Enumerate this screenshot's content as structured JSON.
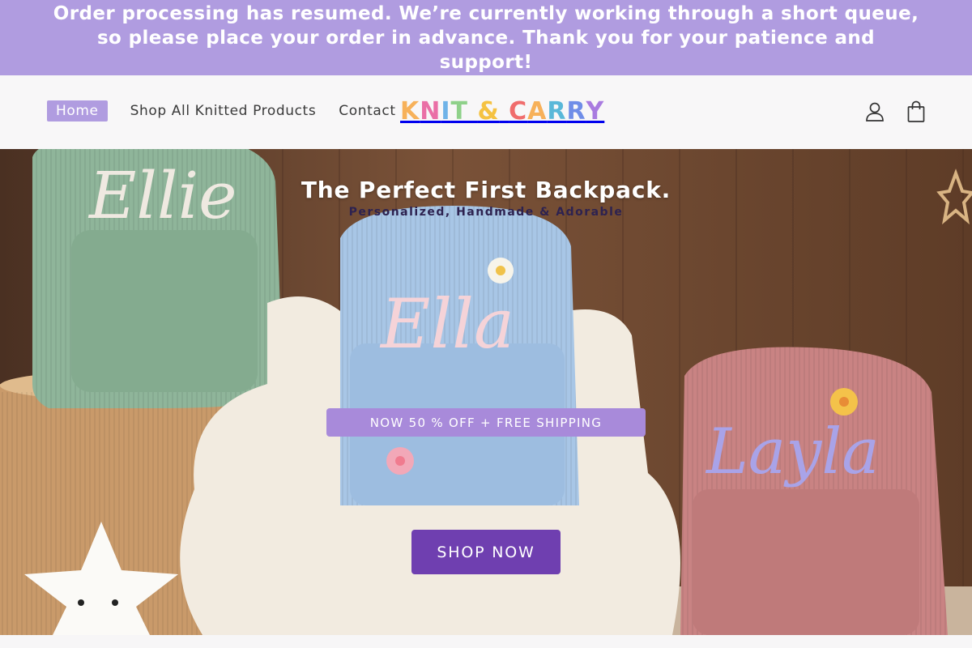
{
  "announcement": {
    "text": "Order processing has resumed. We’re currently working through a short queue, so please place your order in advance. Thank you for your patience and support!"
  },
  "nav": {
    "home": "Home",
    "shop_all": "Shop All Knitted Products",
    "contact": "Contact"
  },
  "logo": {
    "letters": [
      "K",
      "N",
      "I",
      "T",
      " ",
      "&",
      " ",
      "C",
      "A",
      "R",
      "R",
      "Y"
    ],
    "colors": [
      "#f7b15a",
      "#ea6fa6",
      "#6fb3e8",
      "#8fd18a",
      "#000000",
      "#f5c242",
      "#000000",
      "#f06d6d",
      "#f7b15a",
      "#59b8d9",
      "#6f8de8",
      "#a97be0"
    ]
  },
  "icons": {
    "account": "account-icon",
    "cart": "shopping-bag-icon"
  },
  "hero": {
    "title": "The Perfect First Backpack.",
    "subtitle": "Personalized, Handmade & Adorable",
    "promo": "NOW 50 % OFF + FREE SHIPPING",
    "cta": "SHOP NOW",
    "backpack_names": [
      "Ellie",
      "Ella",
      "Layla"
    ]
  },
  "colors": {
    "accent": "#b09ce0",
    "cta": "#6f3fb0"
  }
}
